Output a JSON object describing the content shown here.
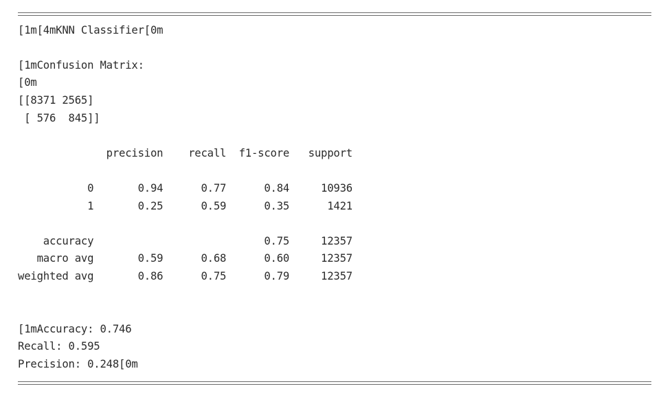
{
  "console": {
    "separator": "==========================================================================",
    "title": "[1m[4mKNN Classifier[0m",
    "confusion_header": "[1mConfusion Matrix:",
    "reset_code": "[0m",
    "matrix_rows": [
      "[[8371 2565]",
      " [ 576  845]]"
    ],
    "report_header": "              precision    recall  f1-score   support",
    "report_rows": [
      "           0       0.94      0.77      0.84     10936",
      "           1       0.25      0.59      0.35      1421",
      "    accuracy                           0.75     12357",
      "   macro avg       0.59      0.68      0.60     12357",
      "weighted avg       0.86      0.75      0.79     12357"
    ],
    "summary": [
      "[1mAccuracy: 0.746",
      "Recall: 0.595",
      "Precision: 0.248[0m"
    ]
  }
}
